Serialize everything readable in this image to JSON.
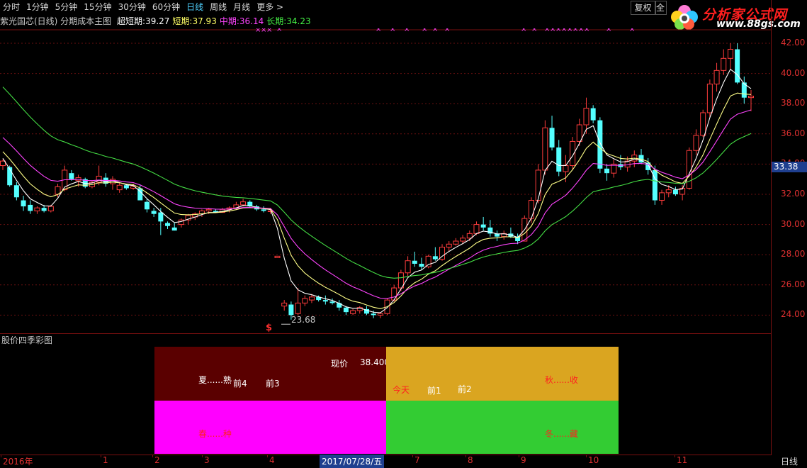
{
  "periods": [
    "分时",
    "1分钟",
    "5分钟",
    "15分钟",
    "30分钟",
    "60分钟",
    "日线",
    "周线",
    "月线",
    "更多 >"
  ],
  "active_period": "日线",
  "buttons": {
    "fuquan": "复权",
    "qt": "全"
  },
  "logo": {
    "brand": "分析家公式网",
    "url": "www.88gs.com"
  },
  "indicator": {
    "title": "紫光国芯(日线) 分期成本主图",
    "items": [
      {
        "label": "超短期:",
        "value": "39.27",
        "color": "#ffffff"
      },
      {
        "label": "短期:",
        "value": "37.93",
        "color": "#ffff66"
      },
      {
        "label": "中期:",
        "value": "36.14",
        "color": "#ff44ff"
      },
      {
        "label": "长期:",
        "value": "34.23",
        "color": "#44ee44"
      }
    ]
  },
  "price_axis": [
    "42.00",
    "40.00",
    "38.00",
    "36.00",
    "34.00",
    "32.00",
    "30.00",
    "28.00",
    "26.00",
    "24.00"
  ],
  "current_price_tag": "33.38",
  "low_label": "23.68",
  "sell_marker": "$",
  "lower_panel": {
    "title": "股价四季彩图",
    "quadrants": {
      "summer": {
        "label": "夏......熟",
        "color": "#5a0000"
      },
      "autumn": {
        "label": "秋......收",
        "color": "#daa520"
      },
      "spring": {
        "label": "春......种",
        "color": "#ff00ff"
      },
      "winter": {
        "label": "冬......藏",
        "color": "#33cc33"
      }
    },
    "price_label": "现价",
    "price_value": "38.400",
    "markers": {
      "q4": "前4",
      "q3": "前3",
      "today": "今天",
      "q1": "前1",
      "q2": "前2"
    }
  },
  "x_axis": {
    "labels": [
      "2016年",
      "1",
      "2",
      "3",
      "4",
      "5",
      "6",
      "7",
      "8",
      "9",
      "10",
      "11"
    ],
    "selected_date": "2017/07/28/五",
    "corner": "日线"
  },
  "chart_data": {
    "type": "candlestick",
    "ylim": [
      23,
      43
    ],
    "series_colors": {
      "up": "#ff3c3c",
      "down": "#54ffff",
      "ultra_short": "#ffffff",
      "short": "#ffff88",
      "mid": "#ff44ff",
      "long": "#44dd44"
    },
    "candles": [
      [
        34.3,
        33.6,
        33.9,
        34.2
      ],
      [
        33.9,
        32.5,
        33.8,
        32.6
      ],
      [
        32.8,
        31.6,
        32.6,
        31.8
      ],
      [
        31.9,
        30.9,
        31.6,
        31.2
      ],
      [
        31.6,
        30.7,
        31.3,
        30.9
      ],
      [
        31.2,
        30.7,
        30.9,
        31.1
      ],
      [
        31.3,
        30.8,
        31.1,
        30.9
      ],
      [
        31.3,
        30.8,
        30.9,
        31.2
      ],
      [
        32.7,
        31.8,
        32.0,
        32.5
      ],
      [
        33.9,
        32.2,
        32.3,
        33.6
      ],
      [
        33.6,
        32.9,
        33.4,
        33.0
      ],
      [
        33.3,
        32.5,
        32.9,
        33.1
      ],
      [
        33.1,
        32.4,
        33.0,
        32.5
      ],
      [
        32.9,
        32.4,
        32.5,
        32.8
      ],
      [
        33.9,
        32.6,
        32.8,
        33.2
      ],
      [
        33.4,
        32.5,
        33.1,
        32.7
      ],
      [
        33.2,
        32.3,
        32.7,
        33.0
      ],
      [
        32.8,
        32.1,
        32.3,
        32.6
      ],
      [
        32.7,
        32.3,
        32.6,
        32.4
      ],
      [
        32.7,
        32.3,
        32.4,
        32.5
      ],
      [
        32.6,
        32.0,
        32.4,
        31.6
      ],
      [
        31.7,
        30.8,
        31.5,
        31.0
      ],
      [
        31.1,
        30.5,
        30.9,
        30.7
      ],
      [
        31.1,
        29.3,
        30.8,
        30.2
      ],
      [
        30.2,
        29.7,
        30.1,
        29.9
      ],
      [
        30.1,
        29.6,
        29.8,
        29.6
      ],
      [
        30.4,
        29.8,
        30.0,
        30.3
      ],
      [
        30.7,
        30.0,
        30.3,
        30.6
      ],
      [
        30.8,
        30.3,
        30.5,
        30.7
      ],
      [
        31.0,
        30.5,
        30.7,
        30.9
      ],
      [
        31.1,
        30.7,
        30.9,
        31.0
      ],
      [
        31.0,
        30.8,
        30.9,
        30.8
      ],
      [
        31.1,
        30.8,
        30.8,
        31.0
      ],
      [
        31.2,
        30.8,
        31.0,
        31.1
      ],
      [
        31.5,
        31.0,
        31.1,
        31.3
      ],
      [
        31.7,
        31.2,
        31.3,
        31.5
      ],
      [
        31.6,
        31.1,
        31.5,
        31.2
      ],
      [
        31.3,
        30.9,
        31.2,
        31.0
      ],
      [
        31.2,
        30.8,
        31.0,
        30.9
      ],
      [
        31.1,
        30.7,
        30.9,
        30.9
      ],
      [
        27.9,
        27.8,
        27.8,
        27.9
      ],
      [
        25.0,
        24.3,
        24.6,
        24.8
      ],
      [
        24.9,
        23.7,
        24.7,
        24.0
      ],
      [
        25.8,
        24.0,
        24.1,
        24.8
      ],
      [
        25.3,
        24.6,
        24.8,
        25.1
      ],
      [
        25.4,
        24.8,
        25.0,
        25.2
      ],
      [
        25.3,
        24.9,
        25.2,
        25.0
      ],
      [
        25.3,
        24.7,
        25.0,
        24.9
      ],
      [
        25.1,
        24.7,
        24.9,
        24.8
      ],
      [
        25.0,
        24.3,
        24.8,
        24.5
      ],
      [
        24.6,
        24.0,
        24.5,
        24.2
      ],
      [
        24.4,
        24.0,
        24.1,
        24.3
      ],
      [
        24.6,
        24.1,
        24.3,
        24.5
      ],
      [
        24.6,
        24.0,
        24.4,
        24.1
      ],
      [
        24.3,
        23.8,
        24.1,
        24.0
      ],
      [
        24.2,
        23.8,
        24.0,
        24.1
      ],
      [
        25.1,
        24.0,
        24.1,
        25.0
      ],
      [
        26.0,
        24.9,
        25.0,
        25.8
      ],
      [
        27.0,
        25.6,
        25.8,
        26.8
      ],
      [
        27.9,
        26.6,
        26.8,
        27.6
      ],
      [
        28.2,
        27.2,
        27.6,
        27.4
      ],
      [
        27.8,
        27.0,
        27.4,
        27.2
      ],
      [
        28.0,
        27.1,
        27.2,
        27.9
      ],
      [
        28.5,
        27.6,
        27.9,
        27.7
      ],
      [
        28.7,
        27.6,
        27.7,
        28.5
      ],
      [
        28.9,
        28.2,
        28.5,
        28.7
      ],
      [
        29.1,
        28.6,
        28.7,
        28.9
      ],
      [
        29.3,
        28.7,
        28.9,
        29.1
      ],
      [
        29.6,
        28.9,
        29.1,
        29.4
      ],
      [
        30.2,
        29.3,
        29.4,
        30.0
      ],
      [
        30.5,
        29.6,
        30.0,
        29.8
      ],
      [
        30.3,
        29.2,
        29.8,
        29.4
      ],
      [
        29.6,
        28.9,
        29.4,
        29.2
      ],
      [
        29.6,
        29.0,
        29.2,
        29.4
      ],
      [
        29.8,
        29.1,
        29.4,
        29.2
      ],
      [
        29.4,
        28.7,
        29.2,
        28.9
      ],
      [
        30.6,
        28.9,
        28.9,
        30.4
      ],
      [
        31.8,
        30.1,
        30.4,
        31.6
      ],
      [
        34.0,
        31.4,
        31.6,
        33.6
      ],
      [
        36.9,
        33.3,
        33.6,
        36.4
      ],
      [
        37.2,
        34.9,
        36.4,
        35.1
      ],
      [
        35.6,
        33.2,
        35.1,
        33.5
      ],
      [
        34.6,
        32.8,
        33.5,
        33.9
      ],
      [
        35.8,
        33.6,
        33.9,
        35.5
      ],
      [
        37.0,
        35.2,
        35.5,
        36.6
      ],
      [
        38.4,
        36.0,
        36.6,
        37.7
      ],
      [
        37.9,
        36.7,
        37.7,
        36.9
      ],
      [
        37.1,
        33.4,
        36.9,
        33.7
      ],
      [
        34.0,
        32.9,
        33.7,
        33.4
      ],
      [
        34.3,
        33.1,
        33.4,
        34.0
      ],
      [
        34.6,
        33.6,
        34.0,
        33.8
      ],
      [
        34.5,
        33.5,
        33.8,
        34.2
      ],
      [
        34.9,
        33.8,
        34.2,
        34.6
      ],
      [
        35.0,
        34.0,
        34.6,
        34.1
      ],
      [
        34.4,
        33.3,
        34.1,
        33.6
      ],
      [
        33.9,
        31.3,
        33.6,
        31.6
      ],
      [
        32.3,
        31.3,
        31.6,
        32.1
      ],
      [
        32.6,
        31.8,
        32.1,
        32.3
      ],
      [
        32.5,
        31.9,
        32.3,
        32.0
      ],
      [
        32.6,
        31.6,
        32.0,
        32.4
      ],
      [
        35.1,
        32.3,
        32.4,
        34.9
      ],
      [
        36.3,
        34.6,
        34.9,
        35.9
      ],
      [
        37.6,
        35.8,
        35.9,
        37.4
      ],
      [
        39.6,
        37.1,
        37.4,
        39.3
      ],
      [
        40.7,
        38.8,
        39.3,
        40.2
      ],
      [
        41.6,
        39.9,
        40.2,
        41.0
      ],
      [
        42.0,
        40.3,
        41.0,
        41.6
      ],
      [
        42.0,
        39.3,
        41.6,
        39.4
      ],
      [
        39.8,
        38.0,
        39.4,
        38.4
      ],
      [
        38.9,
        37.5,
        38.4,
        38.5
      ]
    ]
  }
}
